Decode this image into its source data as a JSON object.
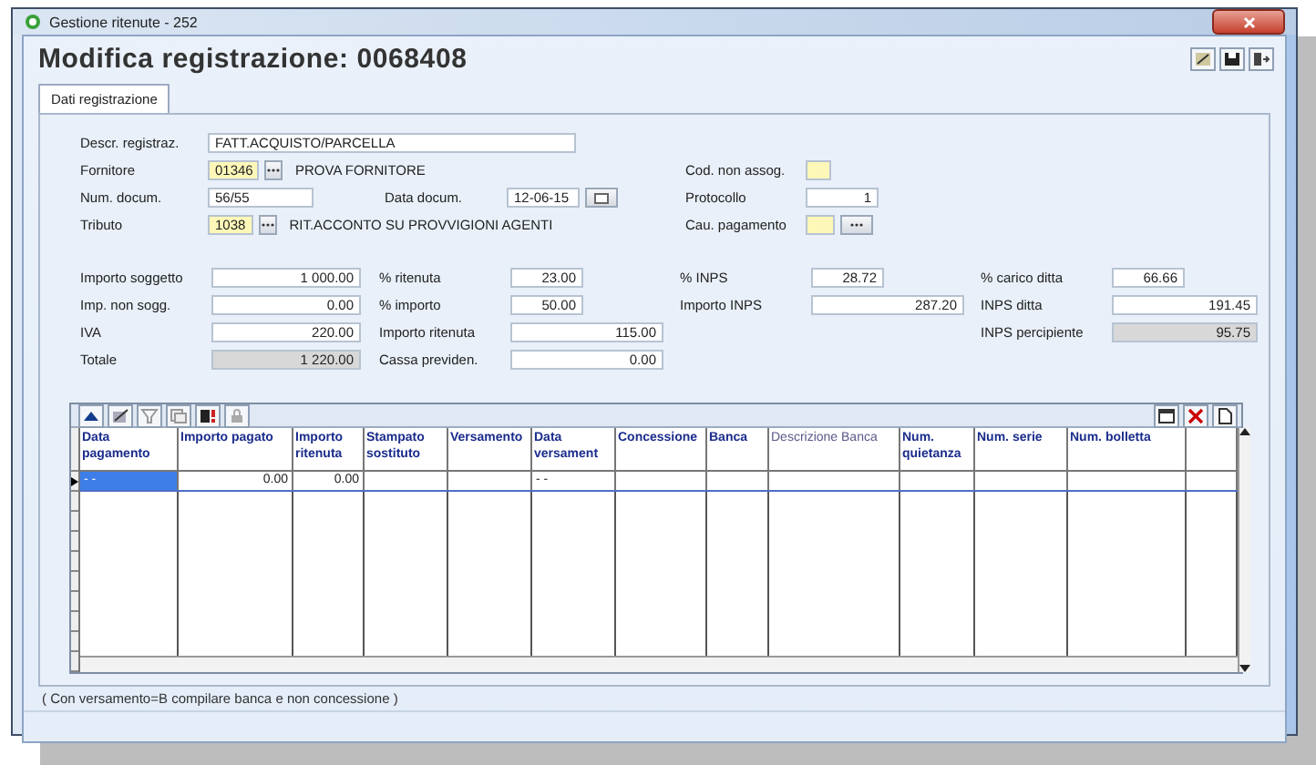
{
  "window": {
    "title": "Gestione ritenute - 252"
  },
  "header": {
    "title": "Modifica  registrazione: 0068408"
  },
  "tabs": [
    {
      "label": "Dati registrazione",
      "selected": true
    }
  ],
  "registration": [
    {
      "left": {
        "label": "Descr. registraz.",
        "value": "FATT.ACQUISTO/PARCELLA",
        "kind": "text"
      }
    },
    {
      "left": {
        "label": "Fornitore",
        "code": "01346",
        "text": "PROVA FORNITORE",
        "kind": "lookup"
      },
      "right": {
        "label": "Cod. non assog.",
        "kind": "flag"
      }
    },
    {
      "left": {
        "label": "Num. docum.",
        "value": "56/55",
        "kind": "text"
      },
      "middle": {
        "label": "Data docum.",
        "value": "12-06-15",
        "kind": "date"
      },
      "right": {
        "label": "Protocollo",
        "value": "1",
        "kind": "number"
      }
    },
    {
      "left": {
        "label": "Tributo",
        "code": "1038",
        "text": "RIT.ACCONTO SU PROVVIGIONI AGENTI",
        "kind": "lookup"
      },
      "right": {
        "label": "Cau. pagamento",
        "kind": "lookup"
      }
    }
  ],
  "amounts": [
    [
      {
        "label": "Importo soggetto",
        "value": "1 000.00",
        "kind": "amount",
        "computed": false
      },
      {
        "label": "Imp. non sogg.",
        "value": "0.00",
        "kind": "amount",
        "computed": false
      },
      {
        "label": "IVA",
        "value": "220.00",
        "kind": "amount",
        "computed": false
      },
      {
        "label": "Totale",
        "value": "1 220.00",
        "kind": "amount",
        "computed": true
      }
    ],
    [
      {
        "label": "% ritenuta",
        "value": "23.00",
        "kind": "percent",
        "computed": false
      },
      {
        "label": "% importo",
        "value": "50.00",
        "kind": "percent",
        "computed": false
      },
      {
        "label": "Importo ritenuta",
        "value": "115.00",
        "kind": "amount",
        "computed": false
      },
      {
        "label": "Cassa previden.",
        "value": "0.00",
        "kind": "amount",
        "computed": false
      }
    ],
    [
      {
        "label": "% INPS",
        "value": "28.72",
        "kind": "percent",
        "computed": false
      },
      {
        "label": "Importo INPS",
        "value": "287.20",
        "kind": "amount",
        "computed": false
      }
    ],
    [
      {
        "label": "% carico ditta",
        "value": "66.66",
        "kind": "percent",
        "computed": false
      },
      {
        "label": "INPS ditta",
        "value": "191.45",
        "kind": "amount",
        "computed": false
      },
      {
        "label": "INPS percipiente",
        "value": "95.75",
        "kind": "amount",
        "computed": true
      }
    ]
  ],
  "table": {
    "columns": [
      {
        "label": "Data pagamento",
        "dim": false
      },
      {
        "label": "Importo pagato",
        "dim": false
      },
      {
        "label": "Importo ritenuta",
        "dim": false
      },
      {
        "label": "Stampato sostituto",
        "dim": false
      },
      {
        "label": "Versamento",
        "dim": false
      },
      {
        "label": "Data versament",
        "dim": false
      },
      {
        "label": "Concessione",
        "dim": false
      },
      {
        "label": "Banca",
        "dim": false
      },
      {
        "label": "Descrizione Banca",
        "dim": true
      },
      {
        "label": "Num. quietanza",
        "dim": false
      },
      {
        "label": "Num. serie",
        "dim": false
      },
      {
        "label": "Num. bolletta",
        "dim": false
      }
    ],
    "rows": [
      {
        "current": true,
        "cells": [
          {
            "text": "- -",
            "selected": true
          },
          {
            "text": "0.00",
            "selected": false
          },
          {
            "text": "0.00",
            "selected": false
          },
          {
            "selected": false
          },
          {
            "selected": false
          },
          {
            "text": "- -",
            "selected": false
          },
          {
            "selected": false
          },
          {
            "selected": false
          },
          {
            "selected": false
          },
          {
            "selected": false
          },
          {
            "selected": false
          },
          {
            "selected": false
          }
        ]
      }
    ]
  },
  "footnote": "( Con versamento=B compilare banca e non concessione )"
}
